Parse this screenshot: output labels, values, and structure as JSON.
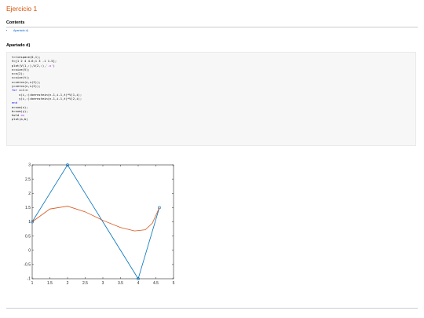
{
  "title": "Ejercicio 1",
  "contents_heading": "Contents",
  "toc": [
    "Apartado d)"
  ],
  "section_heading": "Apartado d)",
  "code": [
    {
      "text": "t=linspace(0,1);"
    },
    {
      "text": "V=[1 2 4 4.6;1 3 -1 1.5];"
    },
    {
      "parts": [
        {
          "t": "plot(V(1,:),V(2,:),"
        },
        {
          "t": "'-o'",
          "c": "str"
        },
        {
          "t": ")"
        }
      ]
    },
    {
      "text": "n=size(V);"
    },
    {
      "text": "n=n(2);"
    },
    {
      "text": "s=size(t);"
    },
    {
      "text": "x=zeros(n,s(2));"
    },
    {
      "text": "y=zeros(n,s(2));"
    },
    {
      "parts": [
        {
          "t": "for",
          "c": "kw"
        },
        {
          "t": " i=1:n"
        }
      ]
    },
    {
      "text": "    x(i,:)=bernstein(n-1,i-1,t)*V(1,i);"
    },
    {
      "text": "    y(i,:)=bernstein(n-1,i-1,t)*V(2,i);"
    },
    {
      "parts": [
        {
          "t": "end",
          "c": "kw"
        }
      ]
    },
    {
      "text": "a=sum(x);"
    },
    {
      "text": "b=sum(y);"
    },
    {
      "parts": [
        {
          "t": "hold "
        },
        {
          "t": "on",
          "c": "str"
        }
      ]
    },
    {
      "text": "plot(a,b)"
    }
  ],
  "chart_data": {
    "type": "line",
    "title": "",
    "xlabel": "",
    "ylabel": "",
    "xlim": [
      1,
      5
    ],
    "ylim": [
      -1,
      3
    ],
    "xticks": [
      "1",
      "1.5",
      "2",
      "2.5",
      "3",
      "3.5",
      "4",
      "4.5",
      "5"
    ],
    "yticks": [
      "-1",
      "-0.5",
      "0",
      "0.5",
      "1",
      "1.5",
      "2",
      "2.5",
      "3"
    ],
    "grid": false,
    "series": [
      {
        "color": "#0072bd",
        "marker": "o",
        "x": [
          1,
          2,
          4,
          4.6
        ],
        "y": [
          1,
          3,
          -1,
          1.5
        ]
      },
      {
        "color": "#d95319",
        "marker": "none",
        "x": [
          1,
          1.5,
          2,
          2.5,
          3,
          3.5,
          3.9,
          4.2,
          4.4,
          4.6
        ],
        "y": [
          1,
          1.45,
          1.55,
          1.35,
          1.05,
          0.8,
          0.68,
          0.72,
          0.95,
          1.5
        ]
      }
    ]
  }
}
